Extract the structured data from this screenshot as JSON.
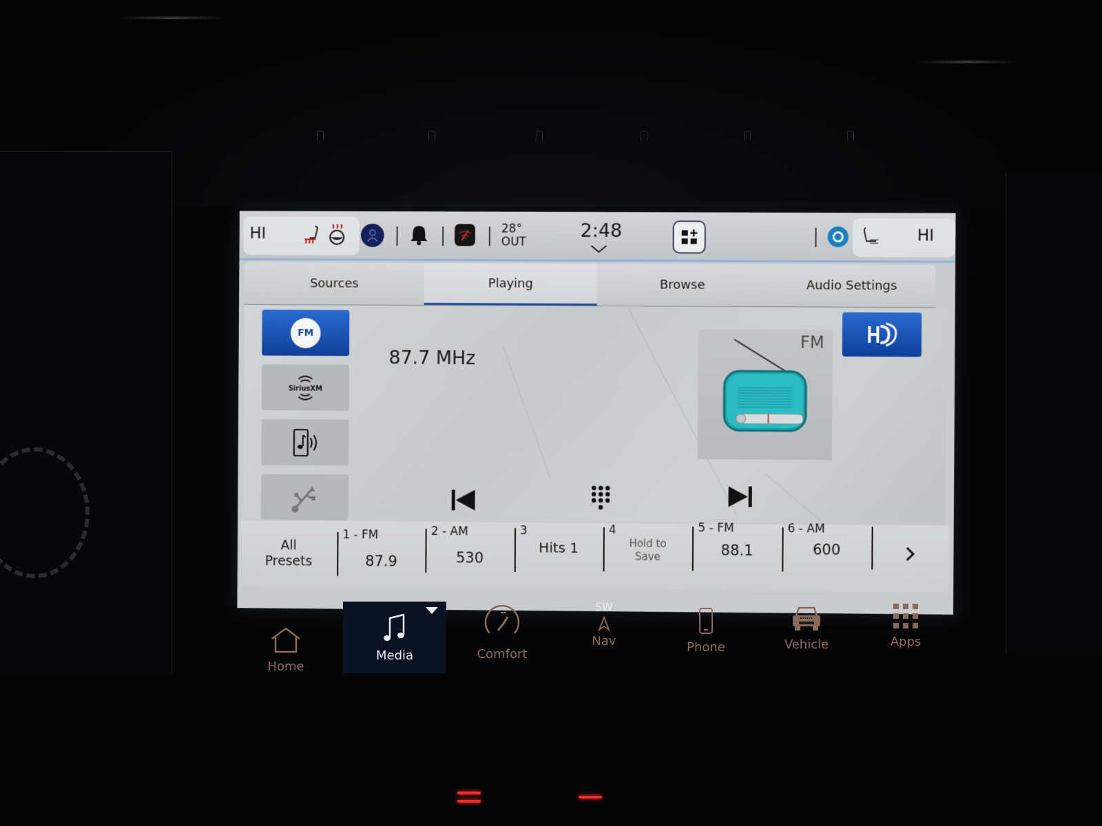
{
  "status_bar": {
    "left_climate_setting": "HI",
    "right_climate_setting": "HI",
    "outside_temp": "28°",
    "outside_label": "OUT",
    "clock": "2:48",
    "icons": [
      "heated-seat-icon",
      "heated-steering-wheel-icon",
      "driver-profile-icon",
      "notification-bell-icon",
      "wifi-off-icon",
      "app-grid-add-icon",
      "alexa-icon",
      "ventilated-seat-icon"
    ]
  },
  "tabs": [
    {
      "label": "Sources",
      "active": false
    },
    {
      "label": "Playing",
      "active": true
    },
    {
      "label": "Browse",
      "active": false
    },
    {
      "label": "Audio Settings",
      "active": false
    }
  ],
  "sources": [
    {
      "name": "FM",
      "badge": "FM",
      "active": true
    },
    {
      "name": "SiriusXM",
      "badge": "SiriusXM",
      "active": false
    },
    {
      "name": "Bluetooth Audio",
      "active": false
    },
    {
      "name": "USB",
      "active": false
    }
  ],
  "now_playing": {
    "frequency": "87.7 MHz",
    "band_art_label": "FM",
    "hd_label": "HD"
  },
  "controls": {
    "previous": "previous-track-icon",
    "keypad": "direct-tune-keypad-icon",
    "next": "next-track-icon"
  },
  "presets": {
    "all_label_line1": "All",
    "all_label_line2": "Presets",
    "items": [
      {
        "number": "1 - FM",
        "value": "87.9"
      },
      {
        "number": "2 - AM",
        "value": "530"
      },
      {
        "number": "3",
        "name": "Hits 1"
      },
      {
        "number": "4",
        "hint_line1": "Hold to",
        "hint_line2": "Save"
      },
      {
        "number": "5 - FM",
        "value": "88.1"
      },
      {
        "number": "6 - AM",
        "value": "600"
      }
    ]
  },
  "bottom_nav": {
    "compass": "SW",
    "items": [
      {
        "label": "Home",
        "active": false
      },
      {
        "label": "Media",
        "active": true
      },
      {
        "label": "Comfort",
        "active": false
      },
      {
        "label": "Nav",
        "active": false
      },
      {
        "label": "Phone",
        "active": false
      },
      {
        "label": "Vehicle",
        "active": false
      },
      {
        "label": "Apps",
        "active": false
      }
    ]
  },
  "colors": {
    "accent_blue": "#1f4fa3",
    "nav_inactive": "#8a6a5c",
    "alexa_blue": "#1a7fc0",
    "radio_teal": "#2bbcc4"
  }
}
